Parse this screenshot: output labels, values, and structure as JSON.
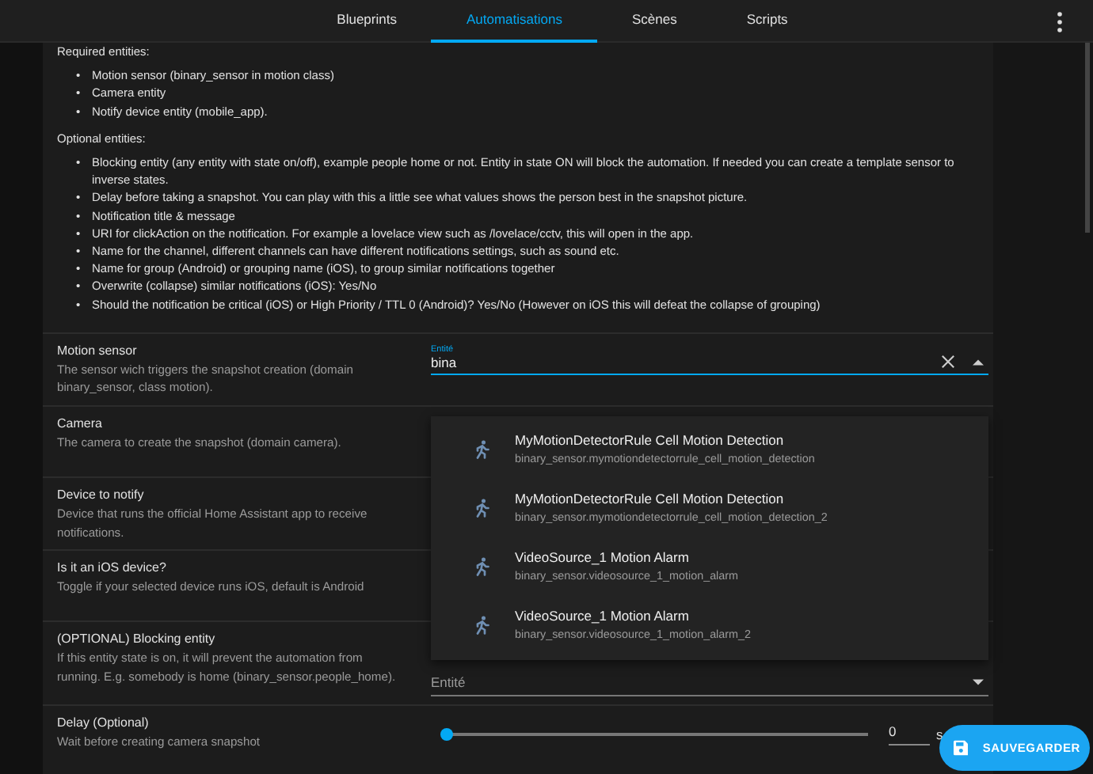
{
  "tabs": [
    {
      "label": "Blueprints",
      "selected": false
    },
    {
      "label": "Automatisations",
      "selected": true
    },
    {
      "label": "Scènes",
      "selected": false
    },
    {
      "label": "Scripts",
      "selected": false
    }
  ],
  "description": {
    "bullet": "•",
    "heading_required": "Required entities:",
    "required": [
      "Motion sensor (binary_sensor in motion class)",
      "Camera entity",
      "Notify device entity (mobile_app)."
    ],
    "heading_optional": "Optional entities:",
    "optional": [
      "Blocking entity (any entity with state on/off), example people home or not. Entity in state ON will block the automation. If needed you can create a template sensor to inverse states.",
      "Delay before taking a snapshot. You can play with this a little see what values shows the person best in the snapshot picture.",
      "Notification title & message",
      "URI for clickAction on the notification. For example a lovelace view such as /lovelace/cctv, this will open in the app.",
      "Name for the channel, different channels can have different notifications settings, such as sound etc.",
      "Name for group (Android) or grouping name (iOS), to group similar notifications together",
      "Overwrite (collapse) similar notifications (iOS): Yes/No",
      "Should the notification be critical (iOS) or High Priority / TTL 0 (Android)? Yes/No (However on iOS this will defeat the collapse of grouping)"
    ]
  },
  "inputs": [
    {
      "title": "Motion sensor",
      "description": "The sensor wich triggers the snapshot creation (domain binary_sensor, class motion).",
      "kind": "search",
      "label": "Entité",
      "value": "bina"
    },
    {
      "title": "Camera",
      "description": "The camera to create the snapshot (domain camera).",
      "kind": "hidden"
    },
    {
      "title": "Device to notify",
      "description": "Device that runs the official Home Assistant app to receive notifications.",
      "kind": "hidden"
    },
    {
      "title": "Is it an iOS device?",
      "description": "Toggle if your selected device runs iOS, default is Android",
      "kind": "hidden"
    },
    {
      "title": "(OPTIONAL) Blocking entity",
      "description": "If this entity state is on, it will prevent the automation from running. E.g. somebody is home (binary_sensor.people_home).",
      "kind": "select",
      "placeholder": "Entité"
    },
    {
      "title": "Delay (Optional)",
      "description": "Wait before creating camera snapshot",
      "kind": "slider",
      "level": 0,
      "value": "0",
      "unit": "s"
    }
  ],
  "suggestions": [
    {
      "name": "MyMotionDetectorRule Cell Motion Detection",
      "entity": "binary_sensor.mymotiondetectorrule_cell_motion_detection"
    },
    {
      "name": "MyMotionDetectorRule Cell Motion Detection",
      "entity": "binary_sensor.mymotiondetectorrule_cell_motion_detection_2"
    },
    {
      "name": "VideoSource_1 Motion Alarm",
      "entity": "binary_sensor.videosource_1_motion_alarm"
    },
    {
      "name": "VideoSource_1 Motion Alarm",
      "entity": "binary_sensor.videosource_1_motion_alarm_2"
    }
  ],
  "save_button": "SAUVEGARDER"
}
